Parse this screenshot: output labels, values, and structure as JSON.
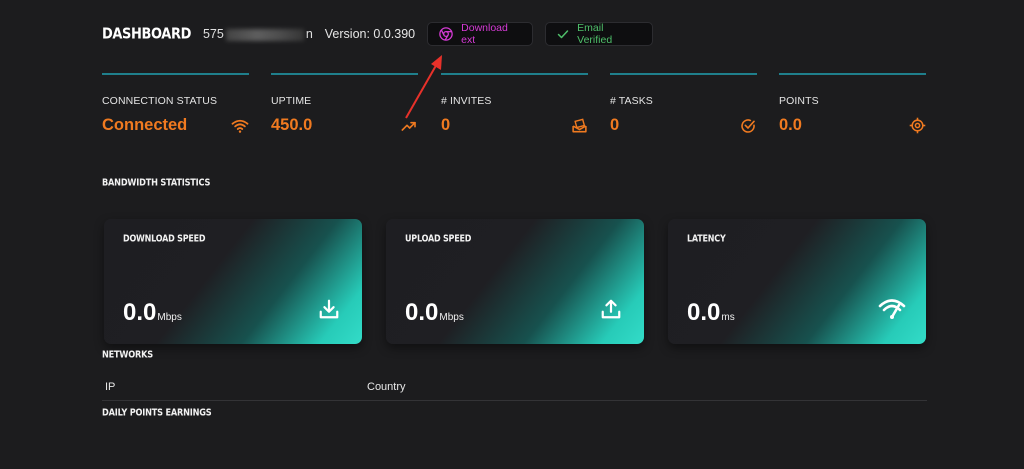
{
  "header": {
    "brand": "DASHBOARD",
    "user_id_prefix": "575",
    "user_id_suffix": "n",
    "version": "Version: 0.0.390",
    "download_ext": "Download ext",
    "email_status": "Email Verified"
  },
  "stats": [
    {
      "label": "CONNECTION STATUS",
      "value": "Connected",
      "icon": "wifi-icon"
    },
    {
      "label": "UPTIME",
      "value": "450.0",
      "icon": "trending-up-icon"
    },
    {
      "label": "# INVITES",
      "value": "0",
      "icon": "invites-icon"
    },
    {
      "label": "# TASKS",
      "value": "0",
      "icon": "check-circle-icon"
    },
    {
      "label": "POINTS",
      "value": "0.0",
      "icon": "target-icon"
    }
  ],
  "sections": {
    "bandwidth": "BANDWIDTH STATISTICS",
    "networks": "NETWORKS",
    "daily": "DAILY POINTS EARNINGS"
  },
  "cards": [
    {
      "title": "DOWNLOAD SPEED",
      "value": "0.0",
      "unit": "Mbps",
      "icon": "download-icon"
    },
    {
      "title": "UPLOAD SPEED",
      "value": "0.0",
      "unit": "Mbps",
      "icon": "upload-icon"
    },
    {
      "title": "LATENCY",
      "value": "0.0",
      "unit": "ms",
      "icon": "signal-icon"
    }
  ],
  "networks": {
    "columns": [
      "IP",
      "Country"
    ]
  },
  "colors": {
    "background": "#1c1c1e",
    "accent_orange": "#f07a20",
    "accent_teal": "#1f7f8c",
    "download_magenta": "#d63bd6",
    "verified_green": "#4fbf6a",
    "annotation_red": "#e8312a"
  }
}
